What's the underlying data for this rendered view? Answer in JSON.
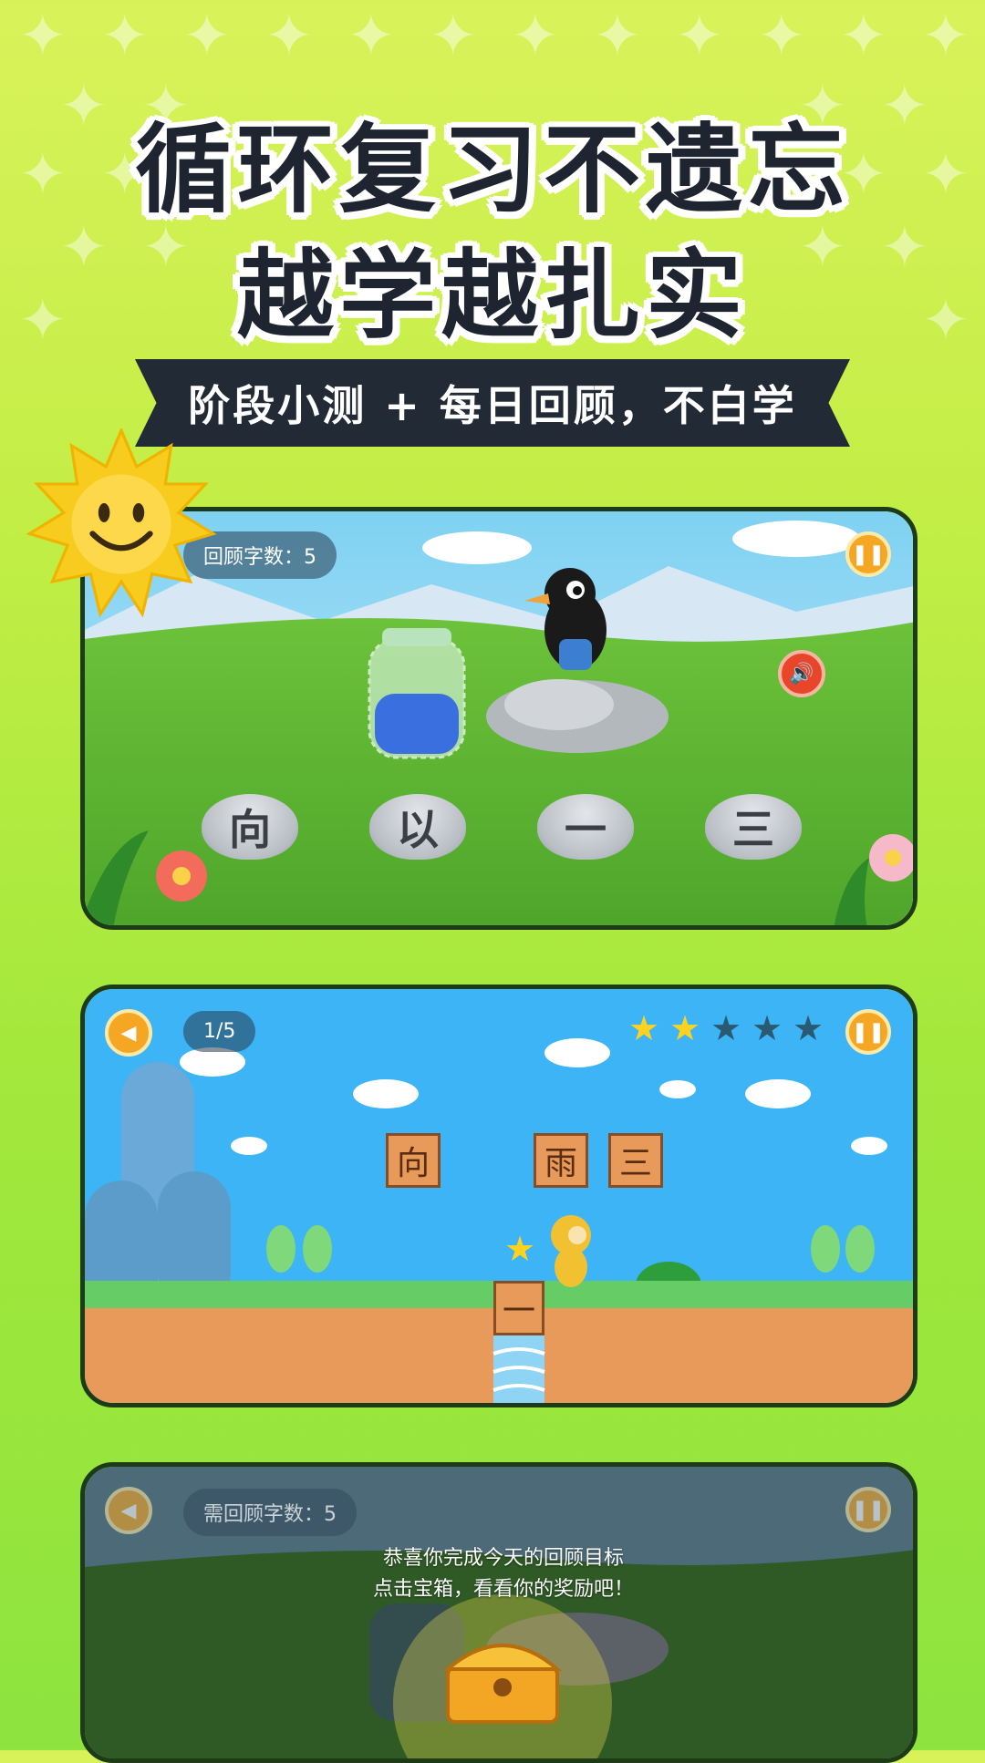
{
  "headline": {
    "line1": "循环复习不遗忘",
    "line2": "越学越扎实"
  },
  "ribbon": {
    "text": "阶段小测 + 每日回顾，不白学"
  },
  "panel1": {
    "review_count_label": "回顾字数：5",
    "stones": [
      "向",
      "以",
      "一",
      "三"
    ],
    "pause_icon": "pause-icon",
    "sound_icon": "speaker-icon"
  },
  "panel2": {
    "progress": "1/5",
    "stars_filled": 2,
    "stars_total": 5,
    "crates": [
      "向",
      "雨",
      "三"
    ],
    "bridge_crate": "一"
  },
  "panel3": {
    "review_count_label": "需回顾字数：5",
    "message_line1": "恭喜你完成今天的回顾目标",
    "message_line2": "点击宝箱，看看你的奖励吧！"
  },
  "colors": {
    "accent": "#f5a623",
    "dark": "#222a36",
    "background_top": "#d9f25a",
    "background_bottom": "#8ee33e"
  }
}
